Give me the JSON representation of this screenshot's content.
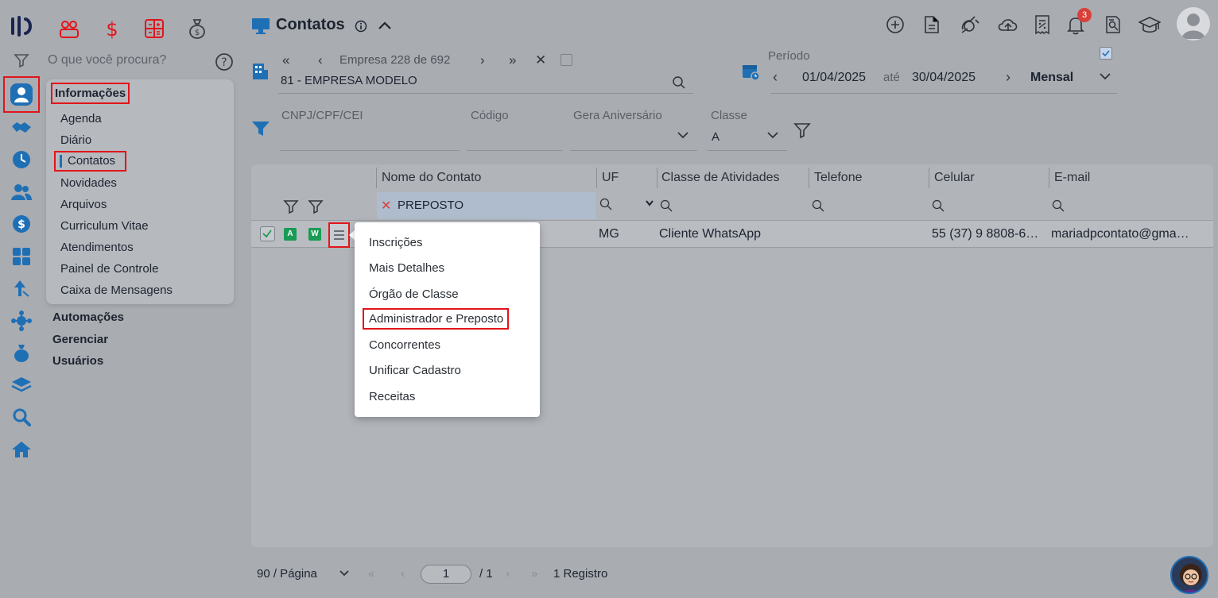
{
  "search": {
    "placeholder": "O que você procura?"
  },
  "menu": {
    "section_info": "Informações",
    "items": [
      "Agenda",
      "Diário",
      "Contatos",
      "Novidades",
      "Arquivos",
      "Curriculum Vitae",
      "Atendimentos",
      "Painel de Controle",
      "Caixa de Mensagens"
    ],
    "sections": [
      "Automações",
      "Gerenciar",
      "Usuários"
    ]
  },
  "header": {
    "title": "Contatos",
    "info_icon": "info-icon",
    "notifications_count": "3"
  },
  "company": {
    "label": "Empresa",
    "current": "228",
    "of": "de",
    "total": "692",
    "name": "81 - EMPRESA MODELO"
  },
  "period": {
    "label": "Período",
    "start": "01/04/2025",
    "until": "até",
    "end": "30/04/2025",
    "mode": "Mensal"
  },
  "filters": {
    "cnpj_label": "CNPJ/CPF/CEI",
    "code_label": "Código",
    "birthday_label": "Gera Aniversário",
    "class_label": "Classe",
    "class_value": "A"
  },
  "grid": {
    "columns": [
      "Nome do Contato",
      "UF",
      "Classe de Atividades",
      "Telefone",
      "Celular",
      "E-mail"
    ],
    "name_filter": "PREPOSTO",
    "row": {
      "badge_a": "A",
      "badge_w": "W",
      "uf": "MG",
      "class": "Cliente WhatsApp",
      "phone": "",
      "mobile": "55 (37) 9 8808-6…",
      "email": "mariadpcontato@gma…"
    }
  },
  "context_menu": {
    "items": [
      "Inscrições",
      "Mais Detalhes",
      "Órgão de Classe",
      "Administrador e Preposto",
      "Concorrentes",
      "Unificar Cadastro",
      "Receitas"
    ]
  },
  "pagination": {
    "page_size": "90 / Página",
    "page": "1",
    "total_pages": "/ 1",
    "records": "1 Registro"
  },
  "colors": {
    "accent": "#1f6fb5",
    "highlight": "#e2151b",
    "badge_green": "#1a9b55"
  }
}
